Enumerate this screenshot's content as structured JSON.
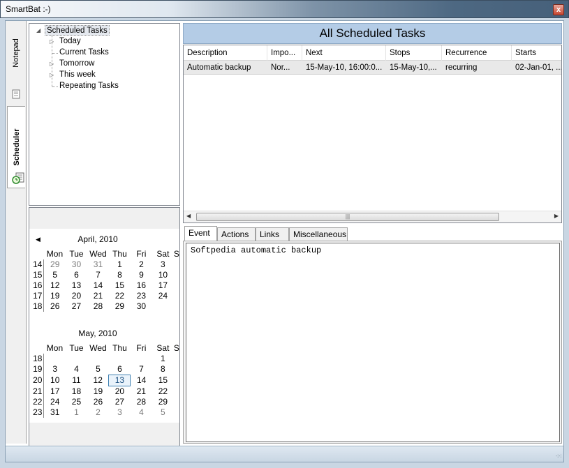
{
  "window": {
    "title": "SmartBat :-)",
    "close_glyph": "x"
  },
  "left_tabs": [
    {
      "label": "Notepad",
      "icon": "notepad-icon"
    },
    {
      "label": "Scheduler",
      "icon": "clock-calendar-icon"
    }
  ],
  "tree": {
    "root": "Scheduled Tasks",
    "children": [
      "Today",
      "Current Tasks",
      "Tomorrow",
      "This week",
      "Repeating Tasks"
    ]
  },
  "calendar": {
    "weekday_headers": [
      "Mon",
      "Tue",
      "Wed",
      "Thu",
      "Fri",
      "Sat",
      "S"
    ],
    "months": [
      {
        "title": "April, 2010",
        "weeks": [
          {
            "wk": "14",
            "days": [
              "29",
              "30",
              "31",
              "1",
              "2",
              "3"
            ],
            "other": [
              true,
              true,
              true,
              false,
              false,
              false
            ]
          },
          {
            "wk": "15",
            "days": [
              "5",
              "6",
              "7",
              "8",
              "9",
              "10"
            ],
            "other": [
              false,
              false,
              false,
              false,
              false,
              false
            ]
          },
          {
            "wk": "16",
            "days": [
              "12",
              "13",
              "14",
              "15",
              "16",
              "17"
            ],
            "other": [
              false,
              false,
              false,
              false,
              false,
              false
            ]
          },
          {
            "wk": "17",
            "days": [
              "19",
              "20",
              "21",
              "22",
              "23",
              "24"
            ],
            "other": [
              false,
              false,
              false,
              false,
              false,
              false
            ]
          },
          {
            "wk": "18",
            "days": [
              "26",
              "27",
              "28",
              "29",
              "30",
              ""
            ],
            "other": [
              false,
              false,
              false,
              false,
              false,
              false
            ]
          }
        ]
      },
      {
        "title": "May, 2010",
        "weeks": [
          {
            "wk": "18",
            "days": [
              "",
              "",
              "",
              "",
              "",
              "1"
            ],
            "other": [
              false,
              false,
              false,
              false,
              false,
              false
            ]
          },
          {
            "wk": "19",
            "days": [
              "3",
              "4",
              "5",
              "6",
              "7",
              "8"
            ],
            "other": [
              false,
              false,
              false,
              false,
              false,
              false
            ]
          },
          {
            "wk": "20",
            "days": [
              "10",
              "11",
              "12",
              "13",
              "14",
              "15"
            ],
            "other": [
              false,
              false,
              false,
              false,
              false,
              false
            ]
          },
          {
            "wk": "21",
            "days": [
              "17",
              "18",
              "19",
              "20",
              "21",
              "22"
            ],
            "other": [
              false,
              false,
              false,
              false,
              false,
              false
            ]
          },
          {
            "wk": "22",
            "days": [
              "24",
              "25",
              "26",
              "27",
              "28",
              "29"
            ],
            "other": [
              false,
              false,
              false,
              false,
              false,
              false
            ]
          },
          {
            "wk": "23",
            "days": [
              "31",
              "1",
              "2",
              "3",
              "4",
              "5"
            ],
            "other": [
              false,
              true,
              true,
              true,
              true,
              true
            ]
          }
        ]
      }
    ],
    "today": "13"
  },
  "main": {
    "header": "All Scheduled Tasks",
    "columns": [
      "Description",
      "Impo...",
      "Next",
      "Stops",
      "Recurrence",
      "Starts"
    ],
    "rows": [
      [
        "Automatic backup",
        "Nor...",
        "15-May-10, 16:00:0...",
        "15-May-10,...",
        "recurring",
        "02-Jan-01, ..."
      ]
    ],
    "scroll_grip": "|||",
    "tabs": [
      "Event",
      "Actions",
      "Links",
      "Miscellaneous"
    ],
    "event_text": "Softpedia automatic backup"
  },
  "colors": {
    "header_bg": "#b4cce6",
    "today_border": "#3c7fb1",
    "selected_row": "#e9e9e9"
  }
}
